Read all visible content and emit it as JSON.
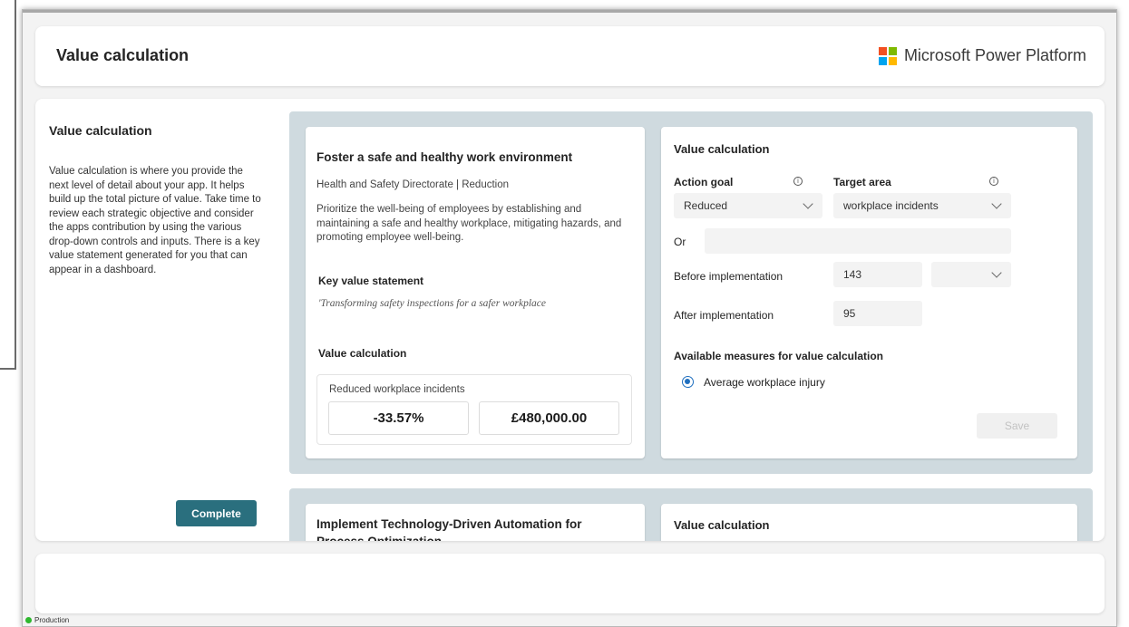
{
  "header": {
    "title": "Value calculation",
    "brand_name": "Microsoft Power Platform",
    "logo_colors": [
      "#f25022",
      "#7fba00",
      "#00a4ef",
      "#ffb900"
    ]
  },
  "intro": {
    "title": "Value calculation",
    "description": "Value calculation is where you provide the next level of detail about your app. It helps build up the total picture of value. Take time to review each strategic objective and consider the apps contribution by using the various drop-down controls and inputs.  There is a key value statement generated for you that can appear in a dashboard.",
    "complete_label": "Complete",
    "complete_color": "#2a6f7e"
  },
  "objectives": [
    {
      "title": "Foster a safe and healthy work environment",
      "subtitle": "Health and Safety Directorate | Reduction",
      "description": "Prioritize the well-being of employees by establishing and maintaining a safe and healthy workplace, mitigating hazards, and promoting employee well-being.",
      "key_value_label": "Key value statement",
      "key_value_text": "'Transforming safety inspections for a safer workplace",
      "value_calc_label": "Value calculation",
      "result_label": "Reduced workplace incidents",
      "result_percent": "-33.57%",
      "result_amount": "£480,000.00",
      "calc": {
        "title": "Value calculation",
        "action_goal_label": "Action goal",
        "action_goal_value": "Reduced",
        "target_area_label": "Target area",
        "target_area_value": "workplace incidents",
        "or_label": "Or",
        "or_value": "",
        "before_label": "Before implementation",
        "before_value": "143",
        "before_unit": "",
        "after_label": "After implementation",
        "after_value": "95",
        "measures_label": "Available measures for value calculation",
        "measure_option": "Average workplace injury",
        "save_label": "Save"
      }
    },
    {
      "title": "Implement Technology-Driven Automation for Process Optimization",
      "calc_title": "Value calculation"
    }
  ],
  "environment": {
    "label": "Production",
    "status_color": "#2eb82e"
  }
}
